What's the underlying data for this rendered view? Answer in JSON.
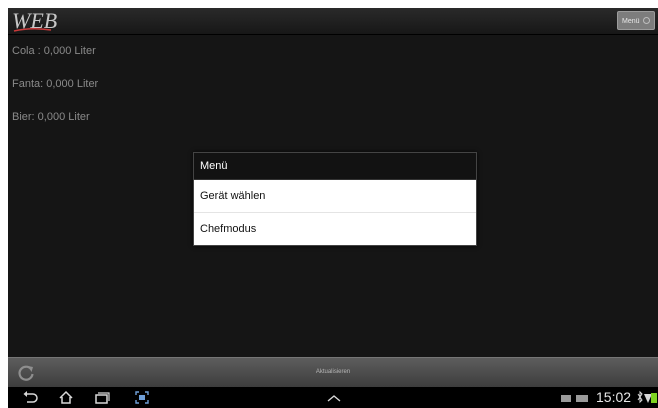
{
  "app": {
    "logo_text": "WEB"
  },
  "actionbar": {
    "menu_label": "Menü"
  },
  "drinks": [
    {
      "label": "Cola : 0,000 Liter"
    },
    {
      "label": "Fanta:  0,000 Liter"
    },
    {
      "label": "Bier:  0,000 Liter"
    }
  ],
  "dialog": {
    "title": "Menü",
    "items": [
      {
        "label": "Gerät wählen"
      },
      {
        "label": "Chefmodus"
      }
    ]
  },
  "bottombar": {
    "refresh_label": "Aktualisieren"
  },
  "statusbar": {
    "time": "15:02"
  },
  "icons": {
    "back": "back-icon",
    "home": "home-icon",
    "recent": "recent-apps-icon",
    "screenshot": "screenshot-icon",
    "up": "chevron-up-icon",
    "refresh": "refresh-icon"
  },
  "colors": {
    "battery": "#7fd321",
    "background": "#151515",
    "dialog_title_bg": "#121212"
  }
}
